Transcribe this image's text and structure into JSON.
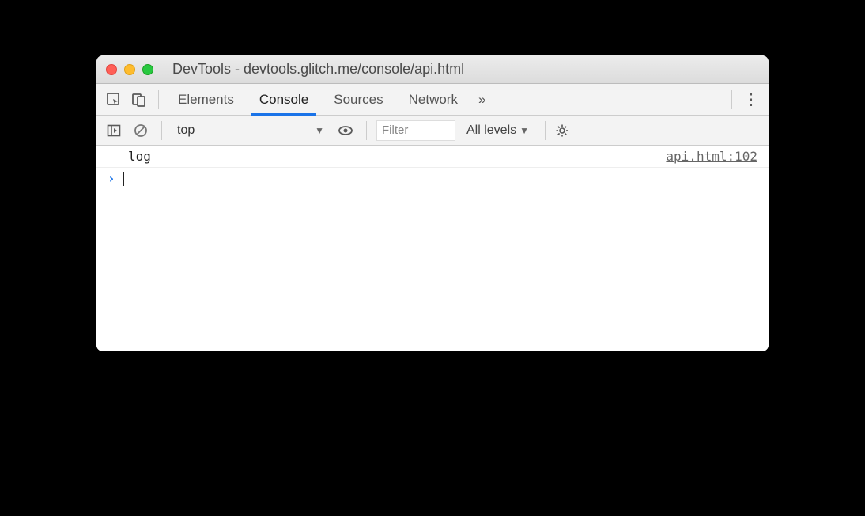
{
  "window": {
    "title": "DevTools - devtools.glitch.me/console/api.html"
  },
  "tabs": {
    "elements": "Elements",
    "console": "Console",
    "sources": "Sources",
    "network": "Network",
    "overflow": "»"
  },
  "subbar": {
    "context": "top",
    "filter_placeholder": "Filter",
    "levels": "All levels"
  },
  "log": {
    "message": "log",
    "source": "api.html:102"
  },
  "prompt": {
    "caret": "›"
  }
}
